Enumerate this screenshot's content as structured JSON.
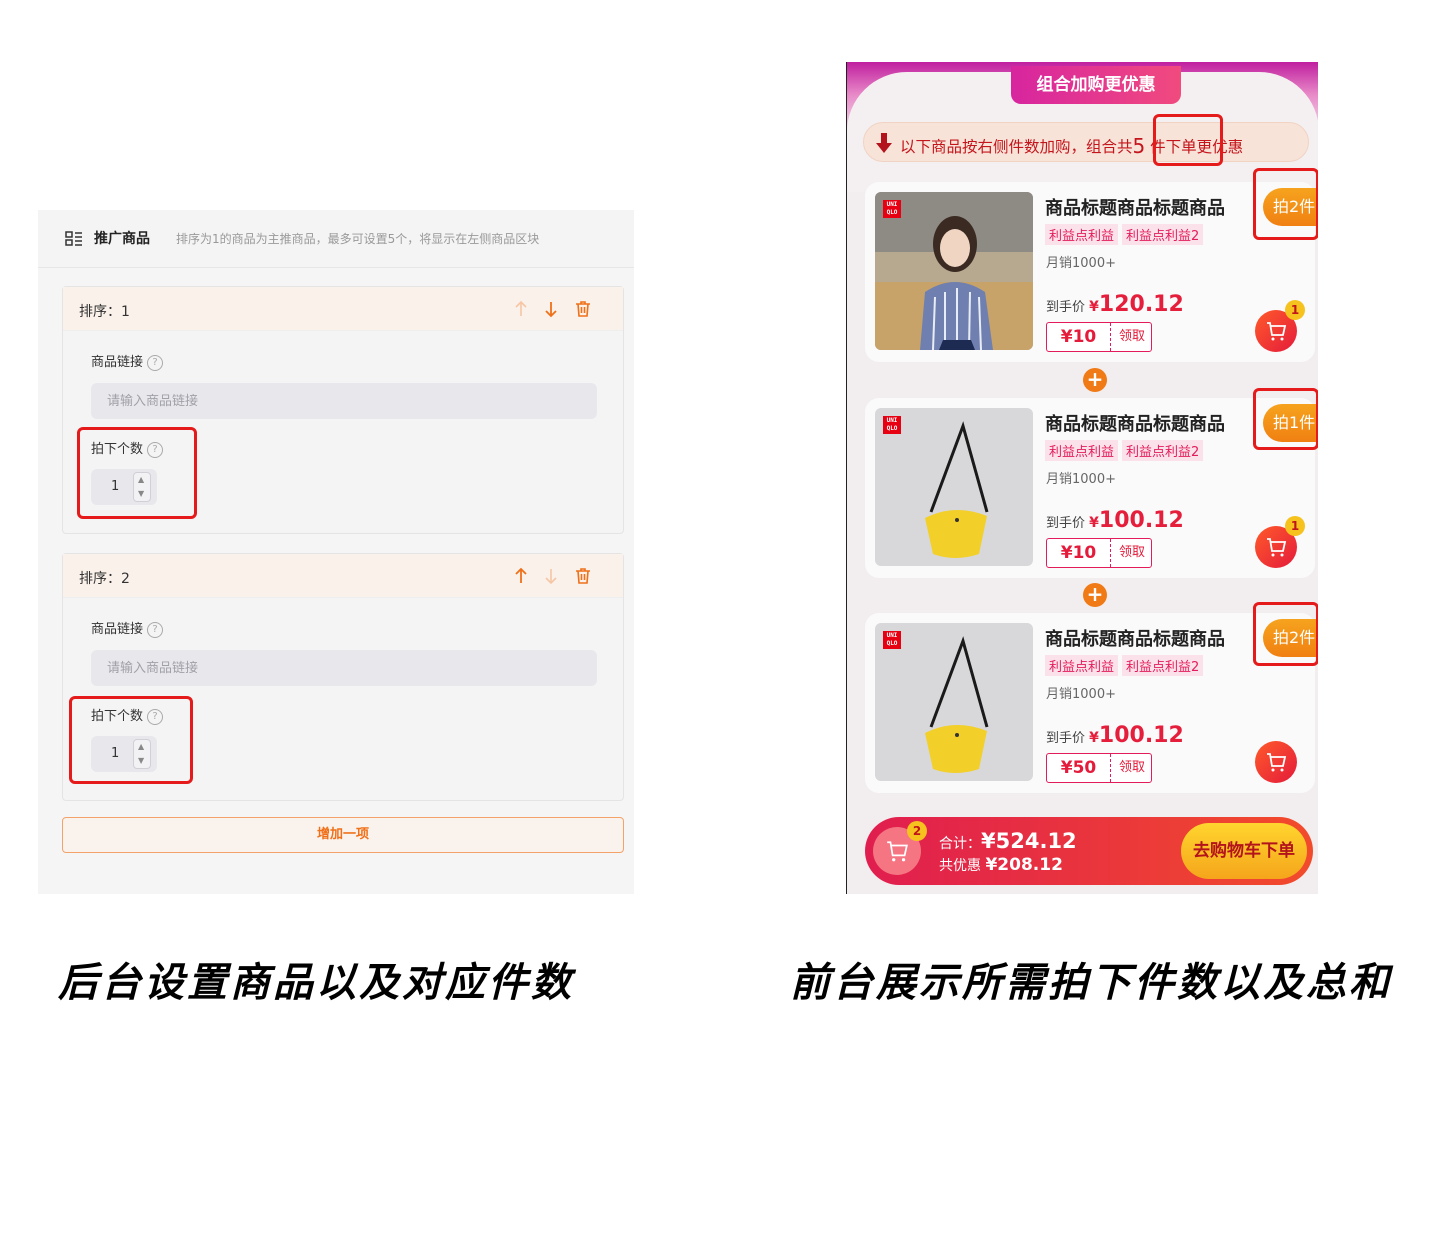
{
  "admin": {
    "header_title": "推广商品",
    "header_desc": "排序为1的商品为主推商品，最多可设置5个，将显示在左侧商品区块",
    "cards": [
      {
        "sort_label": "排序：1",
        "link_label": "商品链接",
        "link_placeholder": "请输入商品链接",
        "qty_label": "拍下个数",
        "qty_value": "1"
      },
      {
        "sort_label": "排序：2",
        "link_label": "商品链接",
        "link_placeholder": "请输入商品链接",
        "qty_label": "拍下个数",
        "qty_value": "1"
      }
    ],
    "add_button": "增加一项",
    "help_glyph": "?"
  },
  "mobile": {
    "title": "组合加购更优惠",
    "notice_before": "以下商品按右侧件数加购，组合共",
    "notice_count": "5",
    "notice_after": " 件下单更优惠",
    "products": [
      {
        "title": "商品标题商品标题商品",
        "tags": [
          "利益点利益",
          "利益点利益2"
        ],
        "sales": "月销1000+",
        "price_label": "到手价",
        "currency": "¥",
        "price": "120.12",
        "coupon": "¥10",
        "coupon_action": "领取",
        "qty": "拍2件",
        "cart_badge": "1",
        "image": "woman-in-striped-shirt",
        "brand_logo": "UNI QLO"
      },
      {
        "title": "商品标题商品标题商品",
        "tags": [
          "利益点利益",
          "利益点利益2"
        ],
        "sales": "月销1000+",
        "price_label": "到手价",
        "currency": "¥",
        "price": "100.12",
        "coupon": "¥10",
        "coupon_action": "领取",
        "qty": "拍1件",
        "cart_badge": "1",
        "image": "yellow-crossbody-bag",
        "brand_logo": "UNI QLO"
      },
      {
        "title": "商品标题商品标题商品",
        "tags": [
          "利益点利益",
          "利益点利益2"
        ],
        "sales": "月销1000+",
        "price_label": "到手价",
        "currency": "¥",
        "price": "100.12",
        "coupon": "¥50",
        "coupon_action": "领取",
        "qty": "拍2件",
        "cart_badge": "",
        "image": "yellow-crossbody-bag",
        "brand_logo": "UNI QLO"
      }
    ],
    "plus_glyph": "+",
    "footer": {
      "cart_badge": "2",
      "total_label": "合计：",
      "total_currency": "¥",
      "total_amount": "524.12",
      "saved_label": "共优惠",
      "saved_currency": "¥",
      "saved_amount": "208.12",
      "checkout_button": "去购物车下单"
    }
  },
  "captions": {
    "left": "后台设置商品以及对应件数",
    "right": "前台展示所需拍下件数以及总和"
  },
  "colors": {
    "highlight": "#e51b1b",
    "accent_orange": "#f07019",
    "price_red": "#e51e3b"
  }
}
